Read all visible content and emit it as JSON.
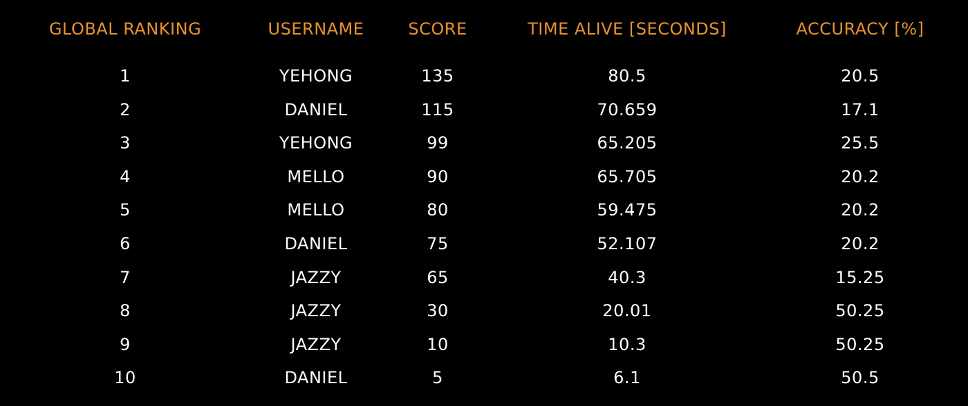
{
  "colors": {
    "background": "#000000",
    "header_text": "#e8922e",
    "row_text": "#ffffff"
  },
  "leaderboard": {
    "headers": {
      "rank": "GLOBAL RANKING",
      "username": "USERNAME",
      "score": "SCORE",
      "time_alive": "TIME ALIVE [SECONDS]",
      "accuracy": "ACCURACY [%]"
    },
    "rows": [
      {
        "rank": "1",
        "username": "YEHONG",
        "score": "135",
        "time_alive": "80.5",
        "accuracy": "20.5"
      },
      {
        "rank": "2",
        "username": "DANIEL",
        "score": "115",
        "time_alive": "70.659",
        "accuracy": "17.1"
      },
      {
        "rank": "3",
        "username": "YEHONG",
        "score": "99",
        "time_alive": "65.205",
        "accuracy": "25.5"
      },
      {
        "rank": "4",
        "username": "MELLO",
        "score": "90",
        "time_alive": "65.705",
        "accuracy": "20.2"
      },
      {
        "rank": "5",
        "username": "MELLO",
        "score": "80",
        "time_alive": "59.475",
        "accuracy": "20.2"
      },
      {
        "rank": "6",
        "username": "DANIEL",
        "score": "75",
        "time_alive": "52.107",
        "accuracy": "20.2"
      },
      {
        "rank": "7",
        "username": "JAZZY",
        "score": "65",
        "time_alive": "40.3",
        "accuracy": "15.25"
      },
      {
        "rank": "8",
        "username": "JAZZY",
        "score": "30",
        "time_alive": "20.01",
        "accuracy": "50.25"
      },
      {
        "rank": "9",
        "username": "JAZZY",
        "score": "10",
        "time_alive": "10.3",
        "accuracy": "50.25"
      },
      {
        "rank": "10",
        "username": "DANIEL",
        "score": "5",
        "time_alive": "6.1",
        "accuracy": "50.5"
      }
    ]
  }
}
